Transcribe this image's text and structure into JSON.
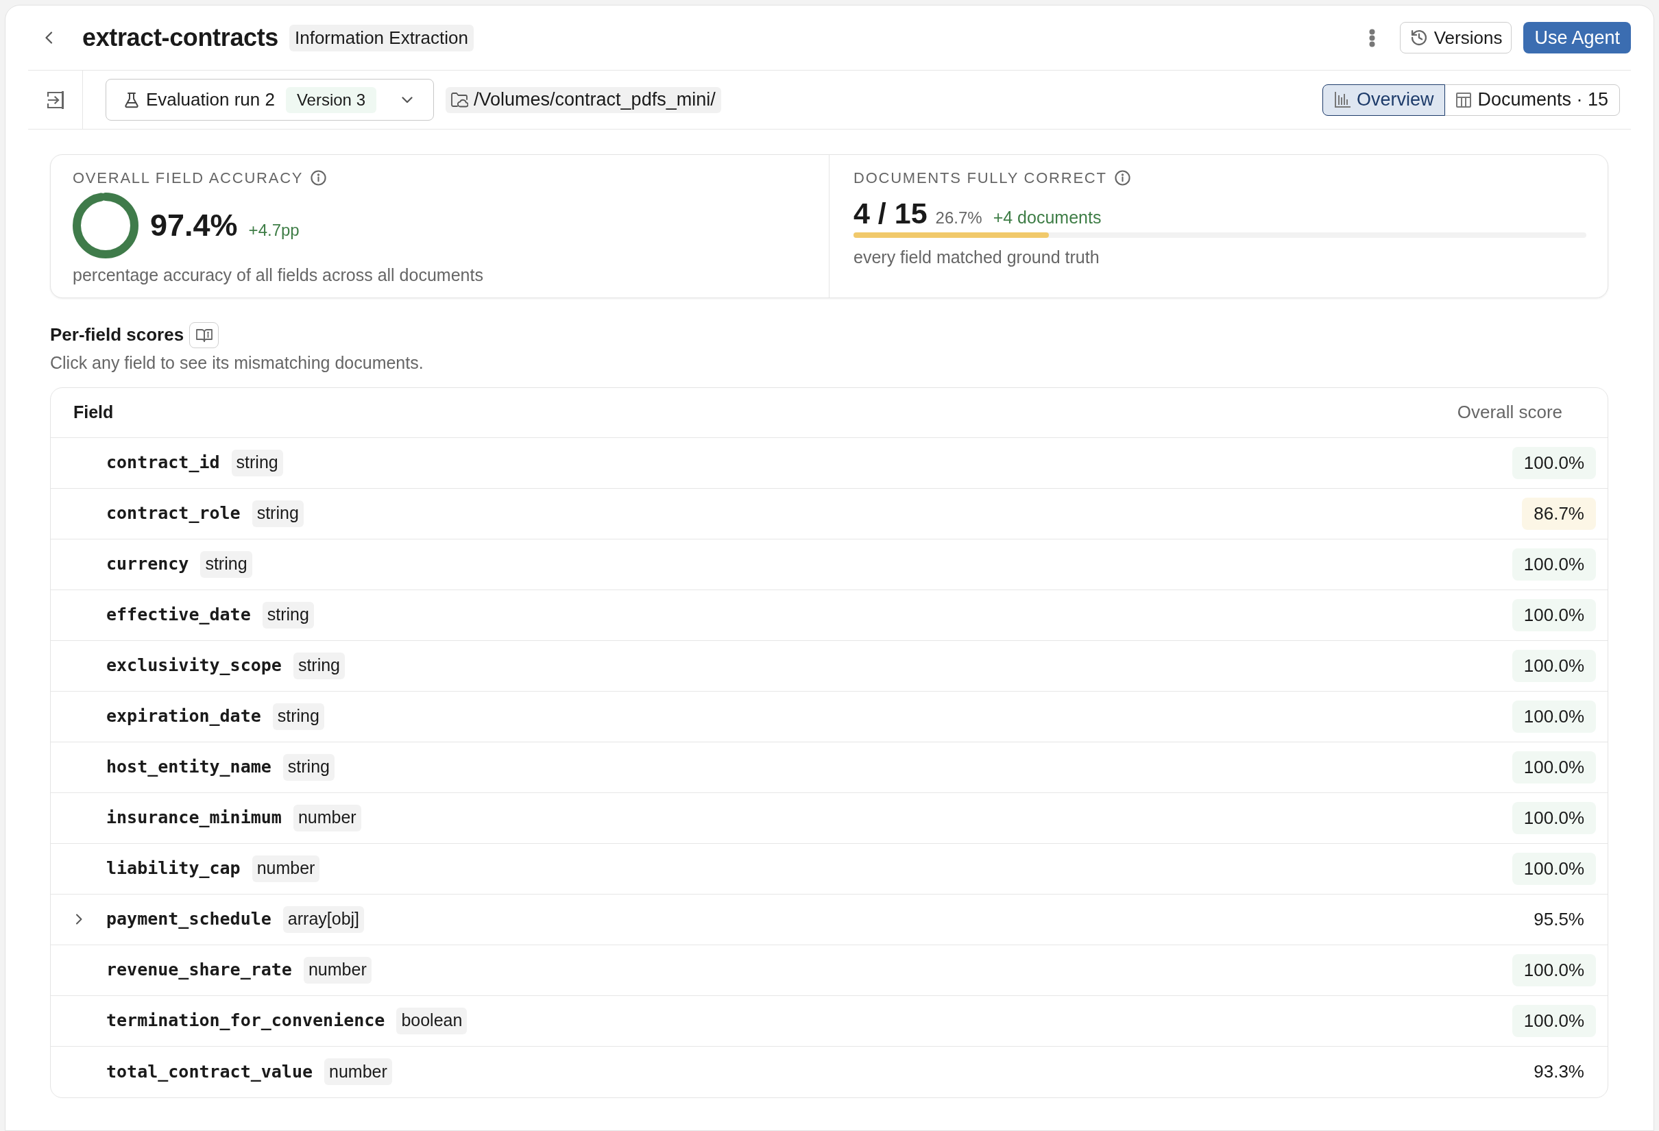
{
  "header": {
    "title": "extract-contracts",
    "badge": "Information Extraction",
    "buttons": [
      {
        "label": "Versions",
        "kind": "secondary"
      },
      {
        "label": "Use Agent",
        "kind": "primary"
      }
    ]
  },
  "toolbar": {
    "run_select": {
      "label": "Evaluation run 2",
      "version": "Version 3"
    },
    "path": "/Volumes/contract_pdfs_mini/",
    "tabs": [
      {
        "label": "Overview",
        "selected": true
      },
      {
        "label": "Documents · 15",
        "selected": false
      }
    ]
  },
  "summary": {
    "overall_accuracy": {
      "label": "OVERALL FIELD ACCURACY",
      "value": "97.4%",
      "change": "+4.7pp",
      "level": 0.974,
      "caption": "percentage accuracy of all fields across all documents"
    },
    "documents_correct": {
      "label": "DOCUMENTS FULLY CORRECT",
      "value": "4 / 15",
      "percent": "26.7%",
      "change": "+4 documents",
      "level": 0.267,
      "caption": "every field matched ground truth"
    }
  },
  "per_field": {
    "title": "Per-field scores",
    "subtitle": "Click any field to see its mismatching documents.",
    "columns": [
      "Field",
      "Overall score"
    ],
    "rows": [
      {
        "name": "contract_id",
        "type": "string",
        "score": "100.0%",
        "color": "#f1f8f3",
        "expandable": false
      },
      {
        "name": "contract_role",
        "type": "string",
        "score": "86.7%",
        "color": "#fcf6e6",
        "expandable": false
      },
      {
        "name": "currency",
        "type": "string",
        "score": "100.0%",
        "color": "#f1f8f3",
        "expandable": false
      },
      {
        "name": "effective_date",
        "type": "string",
        "score": "100.0%",
        "color": "#f1f8f3",
        "expandable": false
      },
      {
        "name": "exclusivity_scope",
        "type": "string",
        "score": "100.0%",
        "color": "#f1f8f3",
        "expandable": false
      },
      {
        "name": "expiration_date",
        "type": "string",
        "score": "100.0%",
        "color": "#f1f8f3",
        "expandable": false
      },
      {
        "name": "host_entity_name",
        "type": "string",
        "score": "100.0%",
        "color": "#f1f8f3",
        "expandable": false
      },
      {
        "name": "insurance_minimum",
        "type": "number",
        "score": "100.0%",
        "color": "#f1f8f3",
        "expandable": false
      },
      {
        "name": "liability_cap",
        "type": "number",
        "score": "100.0%",
        "color": "#f1f8f3",
        "expandable": false
      },
      {
        "name": "payment_schedule",
        "type": "array[obj]",
        "score": "95.5%",
        "expandable": true
      },
      {
        "name": "revenue_share_rate",
        "type": "number",
        "score": "100.0%",
        "color": "#f1f8f3",
        "expandable": false
      },
      {
        "name": "termination_for_convenience",
        "type": "boolean",
        "score": "100.0%",
        "color": "#f1f8f3",
        "expandable": false
      },
      {
        "name": "total_contract_value",
        "type": "number",
        "score": "93.3%",
        "expandable": false
      }
    ]
  }
}
